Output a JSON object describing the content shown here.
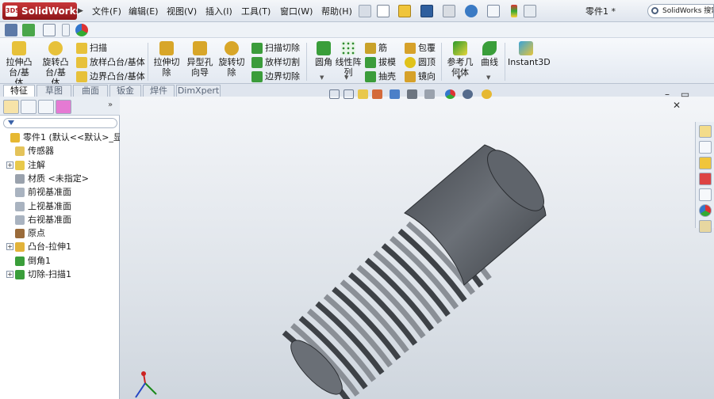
{
  "app": {
    "logo_text": "SolidWorks",
    "logo_badge": "3DS",
    "document_title": "零件1 *",
    "search_placeholder": "SolidWorks 搜索"
  },
  "menu": [
    "文件(F)",
    "编辑(E)",
    "视图(V)",
    "插入(I)",
    "工具(T)",
    "窗口(W)",
    "帮助(H)"
  ],
  "ribbon": {
    "extrude_boss": "拉伸凸台/基体",
    "revolve_boss": "旋转凸台/基体",
    "sweep": "扫描",
    "loft_boss": "放样凸台/基体",
    "boundary_boss": "边界凸台/基体",
    "extrude_cut": "拉伸切除",
    "hole_wizard": "异型孔向导",
    "revolve_cut": "旋转切除",
    "swept_cut": "扫描切除",
    "lofted_cut": "放样切割",
    "boundary_cut": "边界切除",
    "fillet": "圆角",
    "linear_pattern": "线性阵列",
    "rib": "筋",
    "draft": "拔模",
    "shell": "抽壳",
    "wrap": "包覆",
    "dome": "圆顶",
    "mirror": "镜向",
    "reference_geometry": "参考几何体",
    "curves": "曲线",
    "instant3d": "Instant3D"
  },
  "tabs": [
    "特征",
    "草图",
    "曲面",
    "钣金",
    "焊件",
    "DimXpert"
  ],
  "tree": [
    {
      "label": "零件1 (默认<<默认>_显",
      "indent": 0,
      "expander": ""
    },
    {
      "label": "传感器",
      "indent": 1,
      "expander": ""
    },
    {
      "label": "注解",
      "indent": 1,
      "expander": "+"
    },
    {
      "label": "材质 <未指定>",
      "indent": 1,
      "expander": ""
    },
    {
      "label": "前视基准面",
      "indent": 1,
      "expander": ""
    },
    {
      "label": "上视基准面",
      "indent": 1,
      "expander": ""
    },
    {
      "label": "右视基准面",
      "indent": 1,
      "expander": ""
    },
    {
      "label": "原点",
      "indent": 1,
      "expander": ""
    },
    {
      "label": "凸台-拉伸1",
      "indent": 1,
      "expander": "+"
    },
    {
      "label": "倒角1",
      "indent": 1,
      "expander": ""
    },
    {
      "label": "切除-扫描1",
      "indent": 1,
      "expander": "+"
    }
  ],
  "colors": {
    "accent": "#c8373a",
    "part": "#5b5f66"
  }
}
